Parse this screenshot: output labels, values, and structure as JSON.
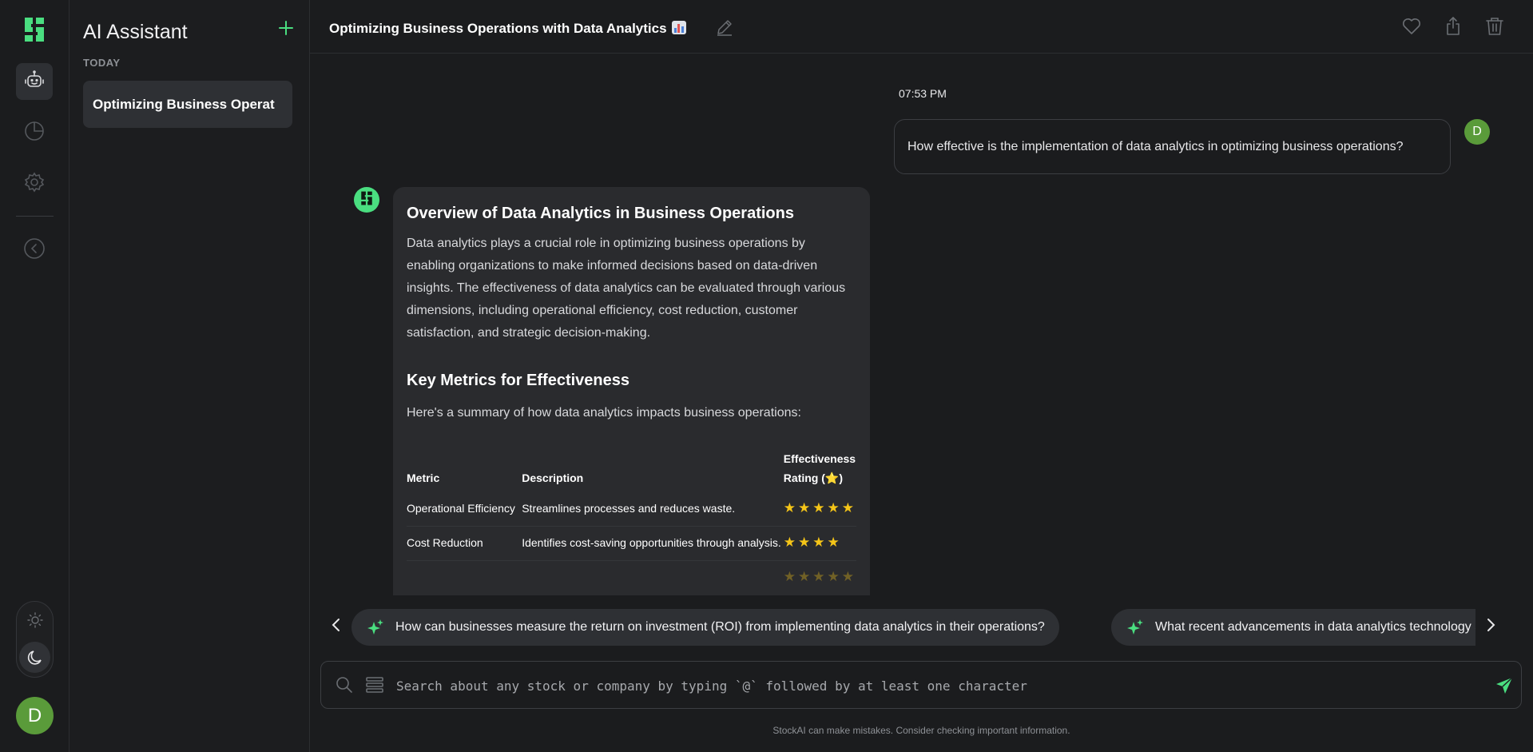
{
  "sidebar": {
    "title": "AI Assistant",
    "section": "TODAY",
    "items": [
      {
        "label": "Optimizing Business Operat"
      }
    ]
  },
  "rail": {
    "avatar_initial": "D",
    "icons": [
      "logo-icon",
      "robot-icon",
      "pie-chart-icon",
      "gear-icon",
      "collapse-icon",
      "sun-icon",
      "moon-icon"
    ]
  },
  "header": {
    "title": "Optimizing Business Operations with Data Analytics",
    "actions": [
      "heart-icon",
      "share-icon",
      "trash-icon"
    ]
  },
  "chat": {
    "timestamp": "07:53 PM",
    "user_initial": "D",
    "user_message": "How effective is the implementation of data analytics in optimizing business operations?",
    "reply": {
      "heading": "Overview of Data Analytics in Business Operations",
      "intro": "Data analytics plays a crucial role in optimizing business operations by enabling organizations to make informed decisions based on data-driven insights. The effectiveness of data analytics can be evaluated through various dimensions, including operational efficiency, cost reduction, customer satisfaction, and strategic decision-making.",
      "subheading": "Key Metrics for Effectiveness",
      "summary": "Here's a summary of how data analytics impacts business operations:",
      "table": {
        "headers": [
          "Metric",
          "Description",
          "Effectiveness Rating (⭐)"
        ],
        "rows": [
          {
            "metric": "Operational Efficiency",
            "description": "Streamlines processes and reduces waste.",
            "rating": 5
          },
          {
            "metric": "Cost Reduction",
            "description": "Identifies cost-saving opportunities through analysis.",
            "rating": 4
          }
        ]
      }
    }
  },
  "suggestions": [
    "How can businesses measure the return on investment (ROI) from implementing data analytics in their operations?",
    "What recent advancements in data analytics technology are"
  ],
  "input": {
    "placeholder": "Search about any stock or company by typing `@` followed by at least one character",
    "value": ""
  },
  "footer": {
    "disclaimer": "StockAI can make mistakes. Consider checking important information."
  },
  "colors": {
    "accent": "#4ade80",
    "avatar": "#5a9b3a",
    "background": "#1b1c1e",
    "bubble": "#2a2b2e",
    "star": "#f5c518"
  }
}
